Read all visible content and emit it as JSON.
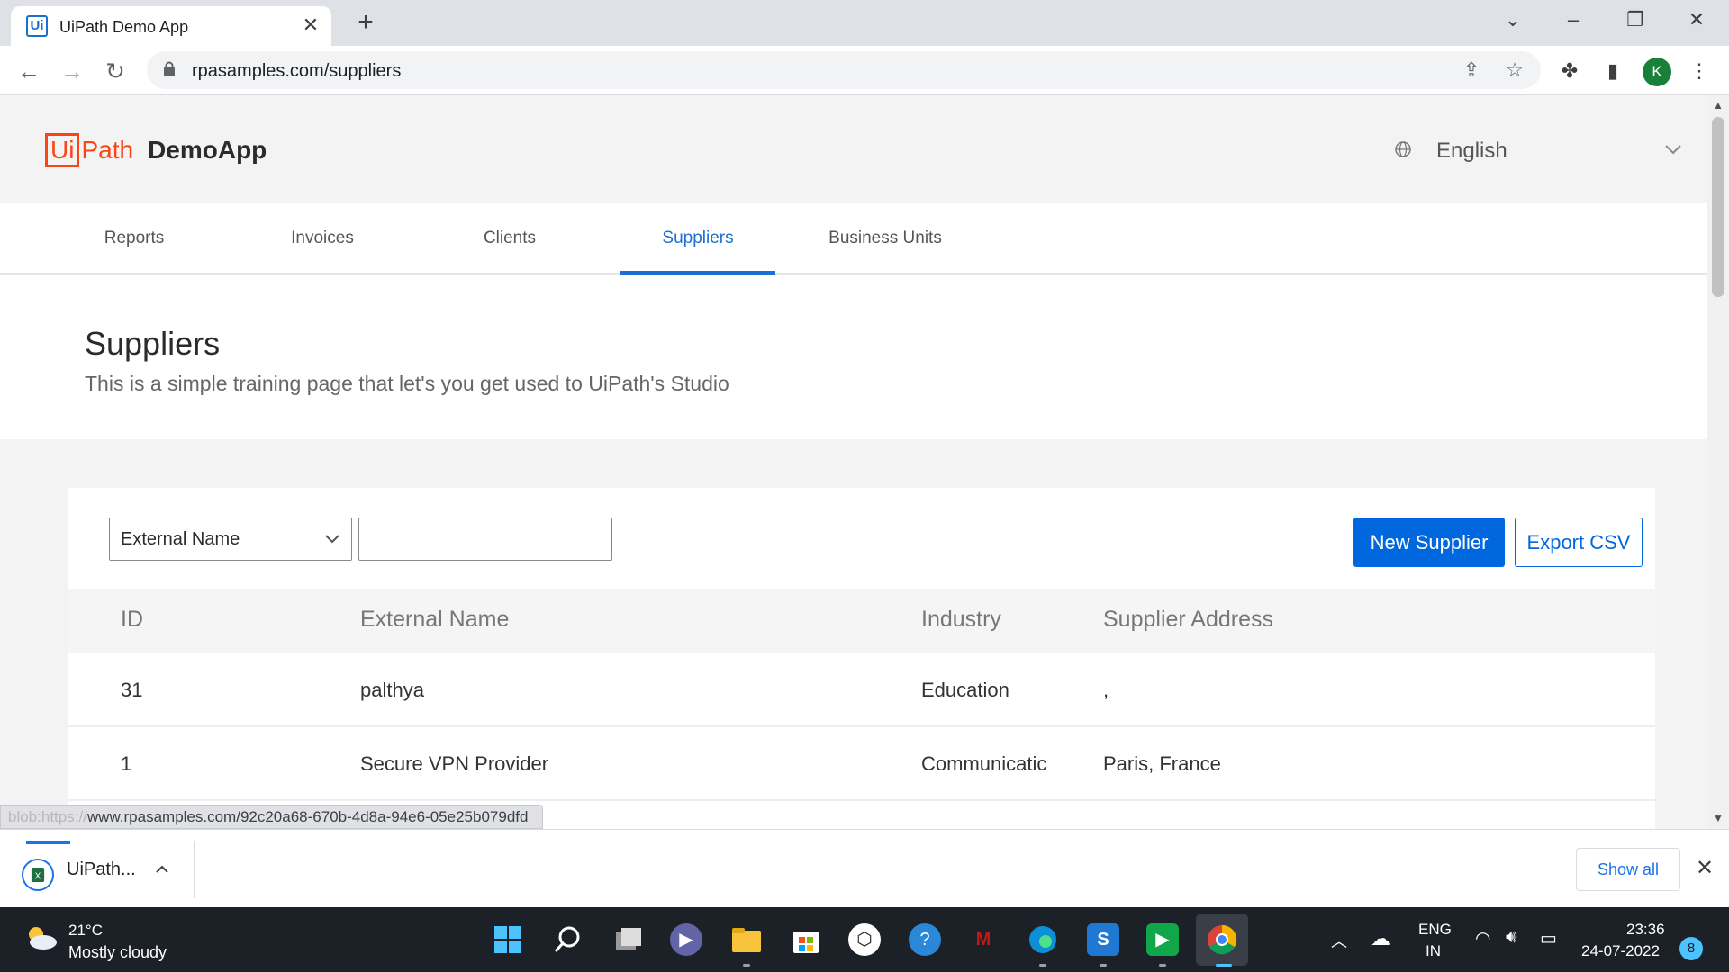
{
  "browser": {
    "tab_title": "UiPath Demo App",
    "tab_favicon": "Ui",
    "url": "rpasamples.com/suppliers",
    "profile_initial": "K",
    "icons": [
      "back-icon",
      "forward-icon",
      "reload-icon",
      "lock-icon",
      "share-icon",
      "star-icon",
      "extensions-icon",
      "sidepanel-icon",
      "menu-icon"
    ]
  },
  "app": {
    "logo_ui": "Ui",
    "logo_path": "Path",
    "logo_app": "DemoApp",
    "language": "English"
  },
  "nav": {
    "tabs": [
      "Reports",
      "Invoices",
      "Clients",
      "Suppliers",
      "Business Units"
    ],
    "active": "Suppliers"
  },
  "page": {
    "title": "Suppliers",
    "subtitle": "This is a simple training page that let's you get used to UiPath's Studio"
  },
  "toolbar": {
    "filter_selected": "External Name",
    "filter_value": "",
    "new_supplier_label": "New Supplier",
    "export_csv_label": "Export CSV"
  },
  "table": {
    "headers": [
      "ID",
      "External Name",
      "Industry",
      "Supplier Address"
    ],
    "rows": [
      [
        "31",
        "palthya",
        "Education",
        ","
      ],
      [
        "1",
        "Secure VPN Provider",
        "Communicatic",
        "Paris, France"
      ]
    ]
  },
  "status": {
    "prefix": "blob:https://",
    "link": "www.rpasamples.com/92c20a68-670b-4d8a-94e6-05e25b079dfd"
  },
  "download_shelf": {
    "file_label": "UiPath...",
    "show_all_label": "Show all"
  },
  "taskbar": {
    "weather_temp": "21°C",
    "weather_desc": "Mostly cloudy",
    "lang_line1": "ENG",
    "lang_line2": "IN",
    "time": "23:36",
    "date": "24-07-2022",
    "notification_count": "8"
  },
  "colors": {
    "accent": "#1b6fd1",
    "primary_button": "#0067df",
    "brand": "#fa4616"
  }
}
